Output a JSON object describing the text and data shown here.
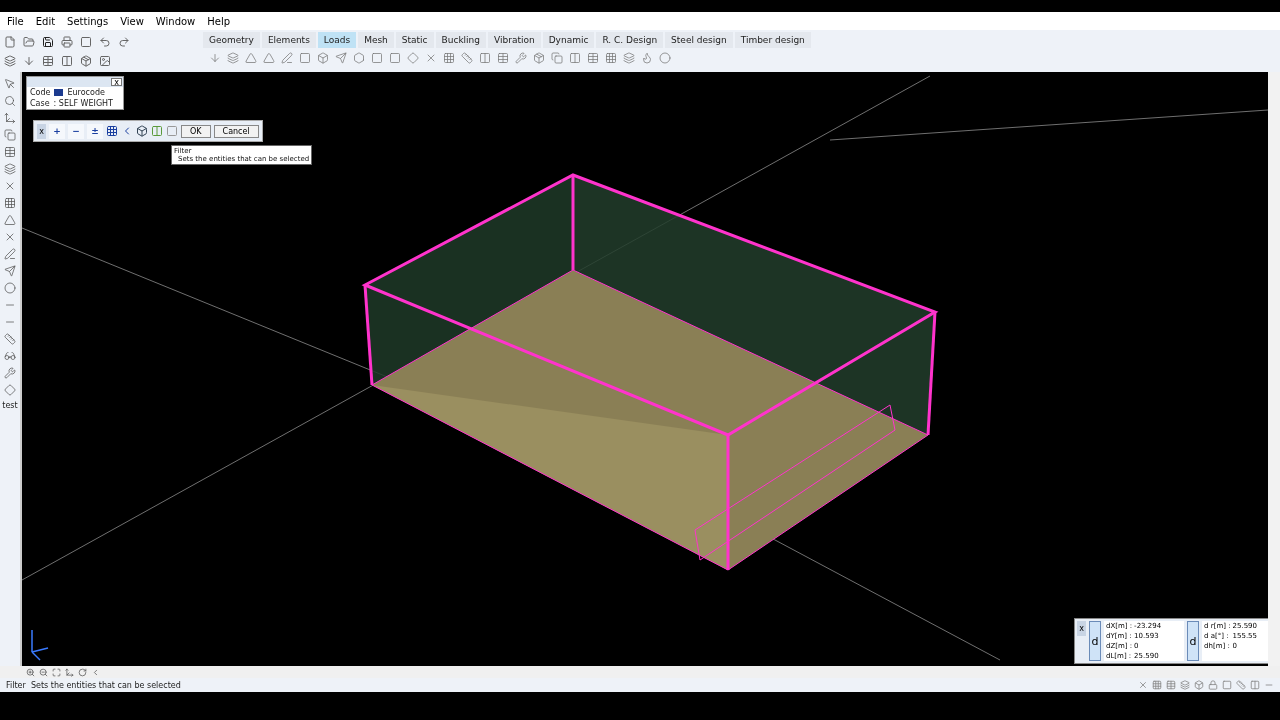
{
  "menu": [
    "File",
    "Edit",
    "Settings",
    "View",
    "Window",
    "Help"
  ],
  "tabs": [
    {
      "label": "Geometry",
      "selected": false
    },
    {
      "label": "Elements",
      "selected": false
    },
    {
      "label": "Loads",
      "selected": true
    },
    {
      "label": "Mesh",
      "selected": false
    },
    {
      "label": "Static",
      "selected": false
    },
    {
      "label": "Buckling",
      "selected": false
    },
    {
      "label": "Vibration",
      "selected": false
    },
    {
      "label": "Dynamic",
      "selected": false
    },
    {
      "label": "R. C. Design",
      "selected": false
    },
    {
      "label": "Steel design",
      "selected": false
    },
    {
      "label": "Timber design",
      "selected": false
    }
  ],
  "info_panel": {
    "close": "x",
    "code_label": "Code",
    "code_value": "Eurocode",
    "case_label": "Case",
    "case_value": ": SELF WEIGHT"
  },
  "selection_toolbar": {
    "close": "x",
    "add": "+",
    "remove": "−",
    "toggle": "±",
    "ok": "OK",
    "cancel": "Cancel"
  },
  "tooltip": {
    "title": "Filter",
    "text": "Sets the entities that can be selected"
  },
  "side_label": "test",
  "coordinates": {
    "close": "x",
    "left_letter": "d",
    "right_letter": "d",
    "left": [
      {
        "label": "dX[m] :",
        "value": "-23.294"
      },
      {
        "label": "dY[m] :",
        "value": "10.593"
      },
      {
        "label": "dZ[m] :",
        "value": "0"
      },
      {
        "label": "dL[m] :",
        "value": "25.590"
      }
    ],
    "right": [
      {
        "label": "d r[m] :",
        "value": "25.590"
      },
      {
        "label": "d a[°] :",
        "value": "155.55"
      },
      {
        "label": "dh[m] :",
        "value": "0"
      }
    ]
  },
  "status_bar": {
    "text": "Filter  Sets the entities that can be selected"
  }
}
